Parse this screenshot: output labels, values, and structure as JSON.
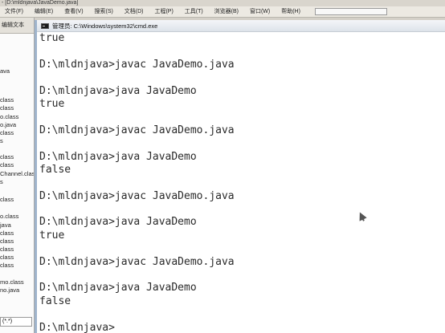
{
  "editor": {
    "title": "- [D:\\mldnjava\\JavaDemo.java]",
    "menus": [
      "文件(F)",
      "编辑(E)",
      "查看(V)",
      "搜索(S)",
      "文档(D)",
      "工程(P)",
      "工具(T)",
      "浏览器(B)",
      "窗口(W)",
      "帮助(H)"
    ],
    "sidebar_tab": "编辑文本",
    "files": [
      "ava",
      "class",
      "class",
      "o.class",
      "o.java",
      "class",
      "s",
      "class",
      "class",
      "Channel.class",
      "s",
      "class",
      "o.class",
      "java",
      "class",
      "class",
      "class",
      "class",
      "class",
      "mo.class",
      "no.java"
    ],
    "status_field": "(*.*)"
  },
  "cmd": {
    "title": "管理员: C:\\Windows\\system32\\cmd.exe",
    "lines": [
      "true",
      "",
      "D:\\mldnjava>javac JavaDemo.java",
      "",
      "D:\\mldnjava>java JavaDemo",
      "true",
      "",
      "D:\\mldnjava>javac JavaDemo.java",
      "",
      "D:\\mldnjava>java JavaDemo",
      "false",
      "",
      "D:\\mldnjava>javac JavaDemo.java",
      "",
      "D:\\mldnjava>java JavaDemo",
      "true",
      "",
      "D:\\mldnjava>javac JavaDemo.java",
      "",
      "D:\\mldnjava>java JavaDemo",
      "false",
      "",
      "D:\\mldnjava>"
    ]
  }
}
